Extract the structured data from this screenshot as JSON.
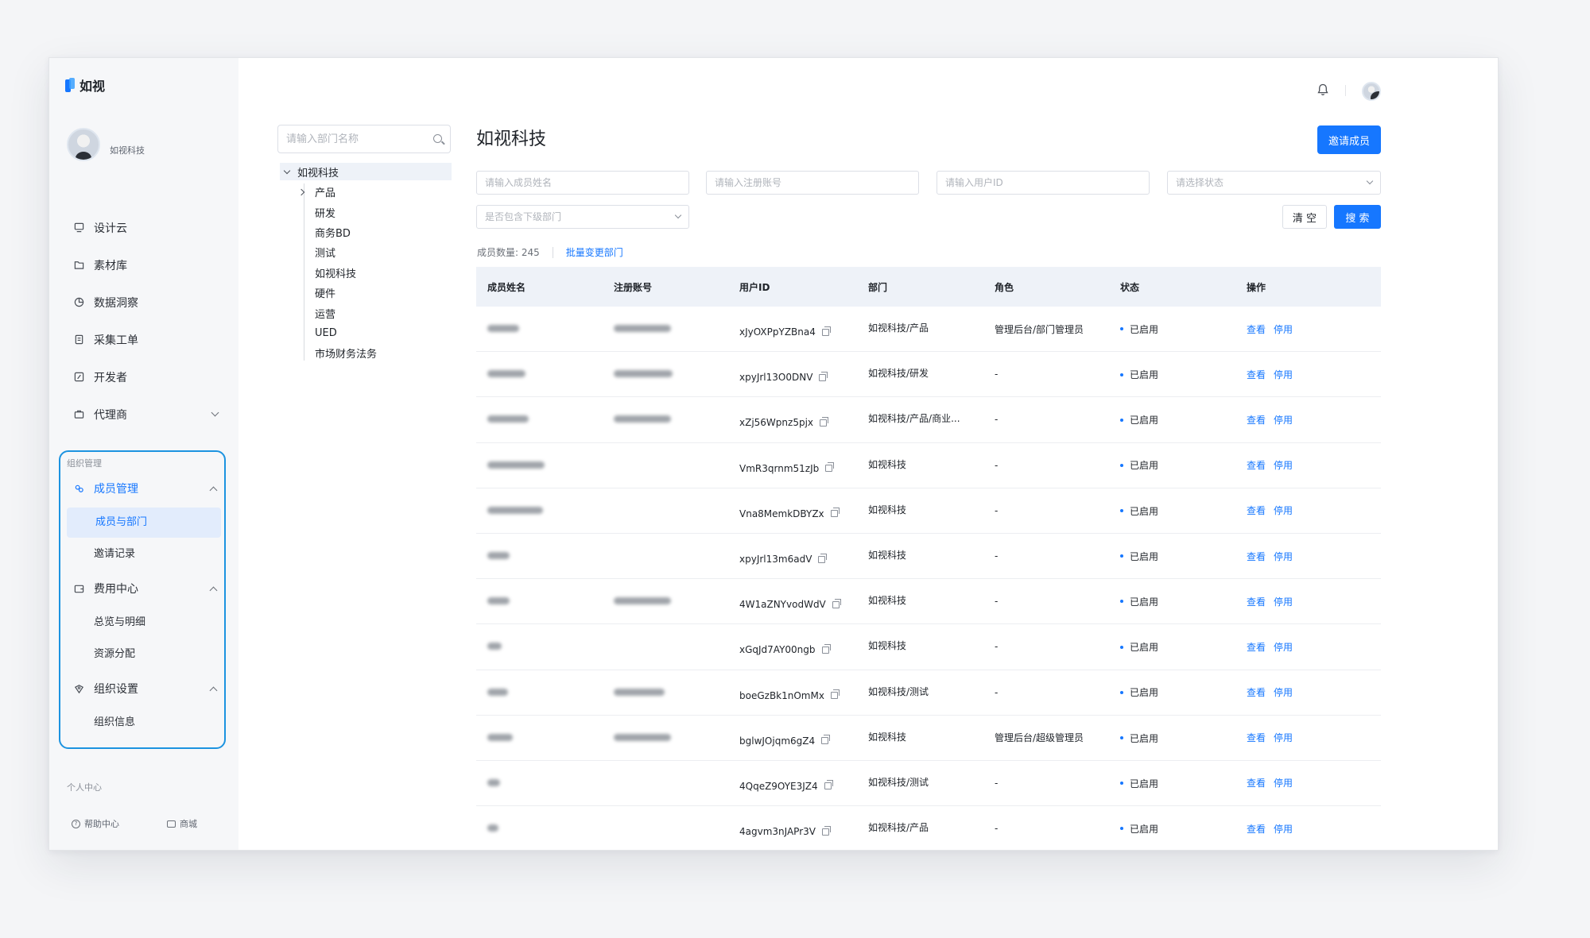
{
  "app": {
    "brand": "如视",
    "org_name": "如视科技"
  },
  "sidebar": {
    "nav": [
      {
        "label": "设计云",
        "icon": "monitor-icon"
      },
      {
        "label": "素材库",
        "icon": "folder-icon"
      },
      {
        "label": "数据洞察",
        "icon": "pie-chart-icon"
      },
      {
        "label": "采集工单",
        "icon": "document-icon"
      },
      {
        "label": "开发者",
        "icon": "code-icon"
      },
      {
        "label": "代理商",
        "icon": "briefcase-icon",
        "expandable": true
      }
    ],
    "org_group_title": "组织管理",
    "groups": [
      {
        "label": "成员管理",
        "icon": "users-icon",
        "items": [
          "成员与部门",
          "邀请记录"
        ],
        "active_item": "成员与部门"
      },
      {
        "label": "费用中心",
        "icon": "wallet-icon",
        "items": [
          "总览与明细",
          "资源分配"
        ]
      },
      {
        "label": "组织设置",
        "icon": "settings-icon",
        "items": [
          "组织信息"
        ]
      }
    ],
    "personal_title": "个人中心",
    "footer": {
      "help": "帮助中心",
      "shop": "商城"
    }
  },
  "tree": {
    "search_placeholder": "请输入部门名称",
    "root": "如视科技",
    "children": [
      "产品",
      "研发",
      "商务BD",
      "测试",
      "如视科技",
      "硬件",
      "运营",
      "UED",
      "市场财务法务"
    ]
  },
  "main": {
    "title": "如视科技",
    "invite_button": "邀请成员",
    "filters": {
      "name_placeholder": "请输入成员姓名",
      "account_placeholder": "请输入注册账号",
      "uid_placeholder": "请输入用户ID",
      "status_placeholder": "请选择状态",
      "subdept_placeholder": "是否包含下级部门"
    },
    "clear_button": "清 空",
    "search_button": "搜 索",
    "member_count_label": "成员数量: 245",
    "batch_change_link": "批量变更部门",
    "columns": [
      "成员姓名",
      "注册账号",
      "用户ID",
      "部门",
      "角色",
      "状态",
      "操作"
    ],
    "rows": [
      {
        "uid": "xJyOXPpYZBna4",
        "dept": "如视科技/产品",
        "role": "管理后台/部门管理员",
        "status": "已启用",
        "view": "查看",
        "disable": "停用"
      },
      {
        "uid": "xpyJrl13O0DNV",
        "dept": "如视科技/研发",
        "role": "-",
        "status": "已启用",
        "view": "查看",
        "disable": "停用"
      },
      {
        "uid": "xZj56Wpnz5pjx",
        "dept": "如视科技/产品/商业...",
        "role": "-",
        "status": "已启用",
        "view": "查看",
        "disable": "停用"
      },
      {
        "uid": "VmR3qrnm51zJb",
        "dept": "如视科技",
        "role": "-",
        "status": "已启用",
        "view": "查看",
        "disable": "停用"
      },
      {
        "uid": "Vna8MemkDBYZx",
        "dept": "如视科技",
        "role": "-",
        "status": "已启用",
        "view": "查看",
        "disable": "停用"
      },
      {
        "uid": "xpyJrl13m6adV",
        "dept": "如视科技",
        "role": "-",
        "status": "已启用",
        "view": "查看",
        "disable": "停用"
      },
      {
        "uid": "4W1aZNYvodWdV",
        "dept": "如视科技",
        "role": "-",
        "status": "已启用",
        "view": "查看",
        "disable": "停用"
      },
      {
        "uid": "xGqJd7AY00ngb",
        "dept": "如视科技",
        "role": "-",
        "status": "已启用",
        "view": "查看",
        "disable": "停用"
      },
      {
        "uid": "boeGzBk1nOmMx",
        "dept": "如视科技/测试",
        "role": "-",
        "status": "已启用",
        "view": "查看",
        "disable": "停用"
      },
      {
        "uid": "bglwJOjqm6gZ4",
        "dept": "如视科技",
        "role": "管理后台/超级管理员",
        "status": "已启用",
        "view": "查看",
        "disable": "停用"
      },
      {
        "uid": "4QqeZ9OYE3JZ4",
        "dept": "如视科技/测试",
        "role": "-",
        "status": "已启用",
        "view": "查看",
        "disable": "停用"
      },
      {
        "uid": "4agvm3nJAPr3V",
        "dept": "如视科技/产品",
        "role": "-",
        "status": "已启用",
        "view": "查看",
        "disable": "停用"
      }
    ]
  },
  "colors": {
    "accent": "#1677ff",
    "highlight_border": "#1c93e0",
    "sidebar_bg": "#f6f7f9",
    "table_header_bg": "#eef2f8"
  }
}
